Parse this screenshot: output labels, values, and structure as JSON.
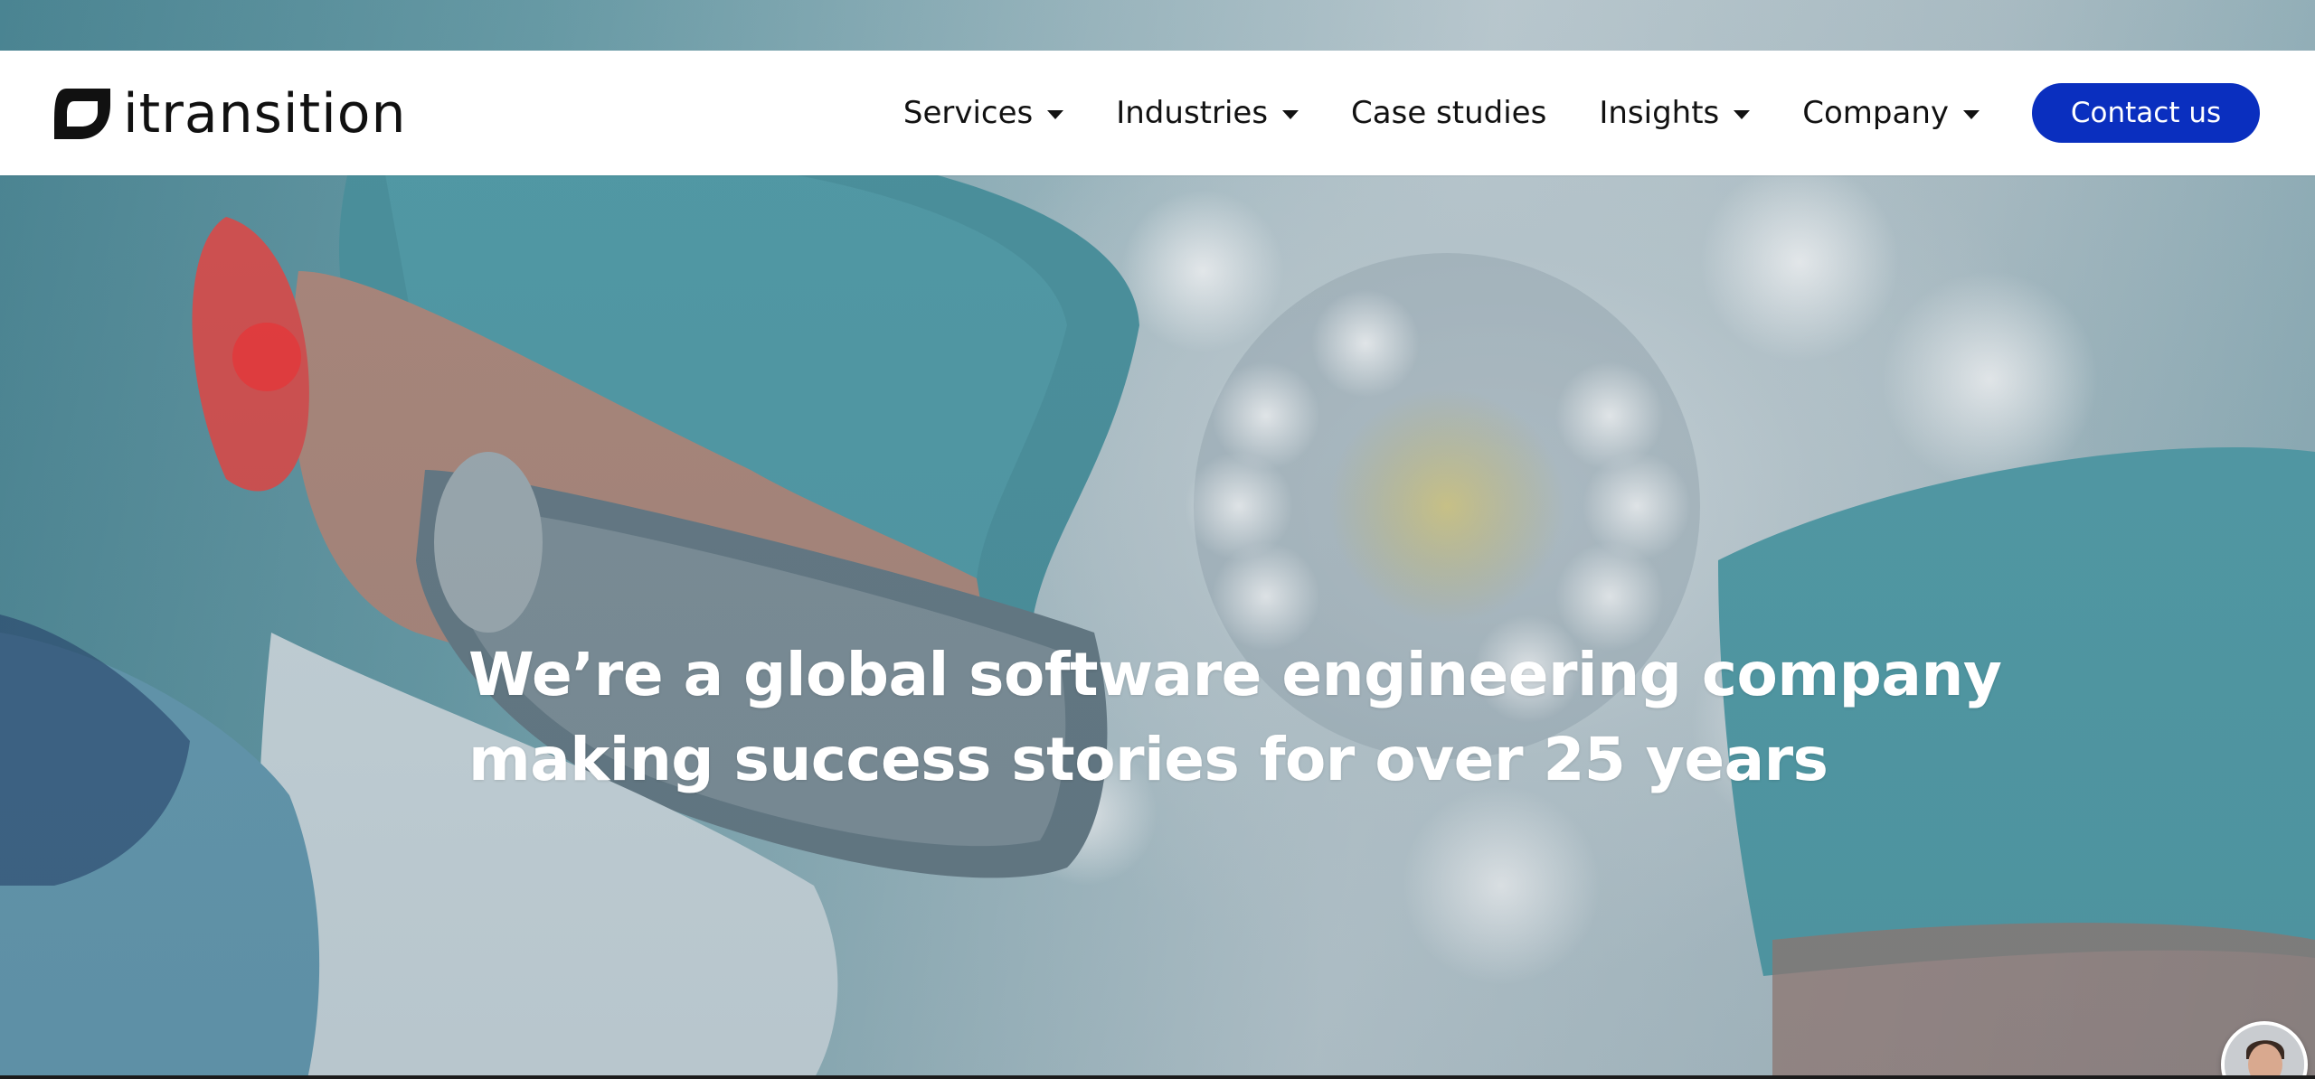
{
  "brand": {
    "name": "itransition",
    "primary_color": "#0a2fbf",
    "logo_icon": "itransition-logo-icon"
  },
  "nav": {
    "items": [
      {
        "label": "Services",
        "has_dropdown": true
      },
      {
        "label": "Industries",
        "has_dropdown": true
      },
      {
        "label": "Case studies",
        "has_dropdown": false
      },
      {
        "label": "Insights",
        "has_dropdown": true
      },
      {
        "label": "Company",
        "has_dropdown": true
      }
    ],
    "contact_label": "Contact us"
  },
  "hero": {
    "headline_line1": "We’re a global software engineering company",
    "headline_line2": "making success stories for over 25 years",
    "background": "surgery-team-photo"
  },
  "chat": {
    "avatar_icon": "chat-agent-avatar-icon"
  }
}
